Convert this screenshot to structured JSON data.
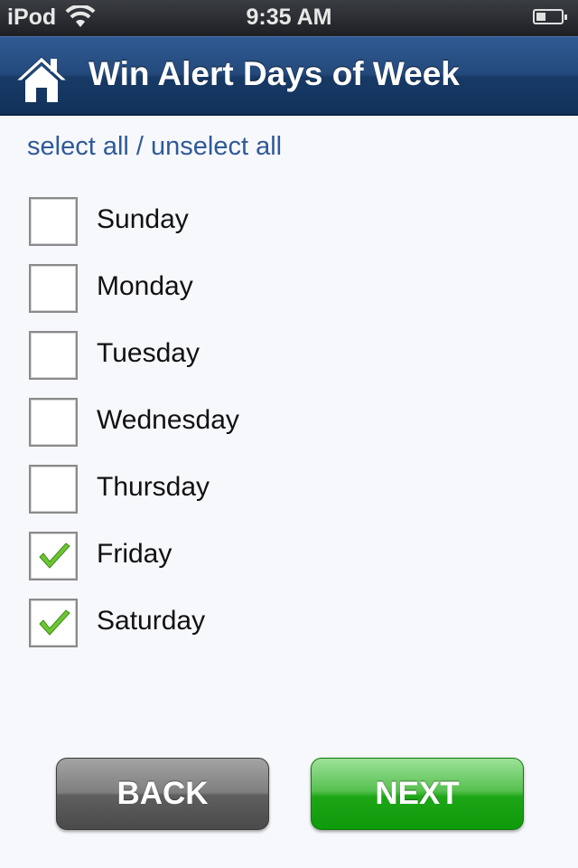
{
  "status_bar": {
    "carrier": "iPod",
    "time": "9:35 AM",
    "battery_level": 0.4
  },
  "header": {
    "title": "Win Alert Days of Week",
    "home_icon": "home-icon"
  },
  "select_all_label": "select all / unselect all",
  "days": [
    {
      "label": "Sunday",
      "checked": false
    },
    {
      "label": "Monday",
      "checked": false
    },
    {
      "label": "Tuesday",
      "checked": false
    },
    {
      "label": "Wednesday",
      "checked": false
    },
    {
      "label": "Thursday",
      "checked": false
    },
    {
      "label": "Friday",
      "checked": true
    },
    {
      "label": "Saturday",
      "checked": true
    }
  ],
  "buttons": {
    "back_label": "BACK",
    "next_label": "NEXT"
  },
  "colors": {
    "header": "#244a7c",
    "link": "#2e5a99",
    "next_button": "#1ea617",
    "back_button": "#6a6a6a",
    "checkmark": "#6cc631"
  }
}
